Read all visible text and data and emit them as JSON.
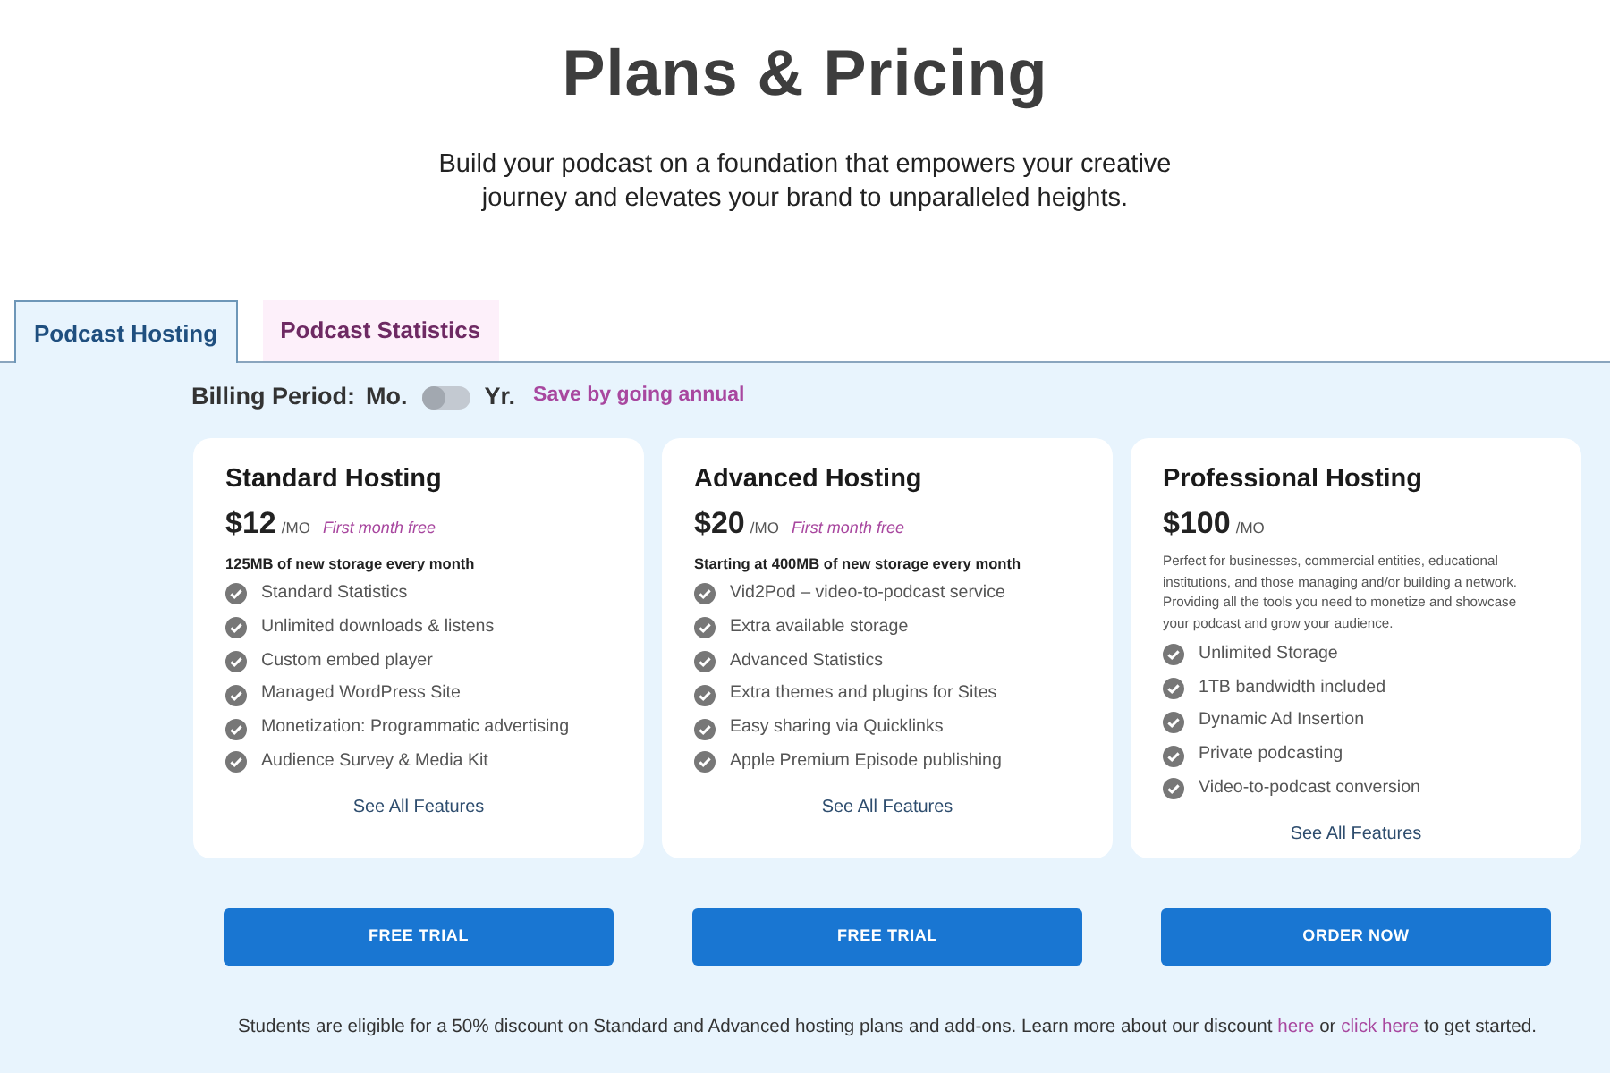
{
  "header": {
    "title": "Plans & Pricing",
    "subtitle": "Build your podcast on a foundation that empowers your creative journey and elevates your brand to unparalleled heights."
  },
  "tabs": [
    {
      "label": "Podcast Hosting",
      "selected": true
    },
    {
      "label": "Podcast Statistics",
      "selected": false
    }
  ],
  "billing": {
    "label": "Billing Period:",
    "monthly_label": "Mo.",
    "annual_label": "Yr.",
    "annual_on": false,
    "note": "Save by going annual"
  },
  "plans": [
    {
      "name": "Standard Hosting",
      "price": "$12",
      "period": "/MO",
      "promo": "First month free",
      "storage": "125MB of new storage every month",
      "features": [
        "Standard Statistics",
        "Unlimited downloads & listens",
        "Custom embed player",
        "Managed WordPress Site",
        "Monetization: Programmatic advertising",
        "Audience Survey & Media Kit"
      ],
      "link": "See All Features",
      "button": "FREE TRIAL"
    },
    {
      "name": "Advanced Hosting",
      "price": "$20",
      "period": "/MO",
      "promo": "First month free",
      "storage": "Starting at 400MB of new storage every month",
      "features": [
        "Vid2Pod – video-to-podcast service",
        "Extra available storage",
        "Advanced Statistics",
        "Extra themes and plugins for Sites",
        "Easy sharing via Quicklinks",
        "Apple Premium Episode publishing"
      ],
      "link": "See All Features",
      "button": "FREE TRIAL"
    },
    {
      "name": "Professional Hosting",
      "price": "$100",
      "period": "/MO",
      "description": "Perfect for businesses, commercial entities, educational institutions, and those managing and/or building a network. Providing all the tools you need to monetize and showcase your podcast and grow your audience.",
      "features": [
        "Unlimited Storage",
        "1TB bandwidth included",
        "Dynamic Ad Insertion",
        "Private podcasting",
        "Video-to-podcast conversion"
      ],
      "link": "See All Features",
      "button": "ORDER NOW"
    }
  ],
  "footer": [
    {
      "kind": "text",
      "text": "Students are eligible for a 50% discount on Standard and Advanced hosting plans and add-ons. Learn more about our discount"
    },
    {
      "kind": "link",
      "text": "here"
    },
    {
      "kind": "text",
      "text": "or"
    },
    {
      "kind": "link",
      "text": "click here"
    },
    {
      "kind": "text",
      "text": "to get started."
    }
  ]
}
